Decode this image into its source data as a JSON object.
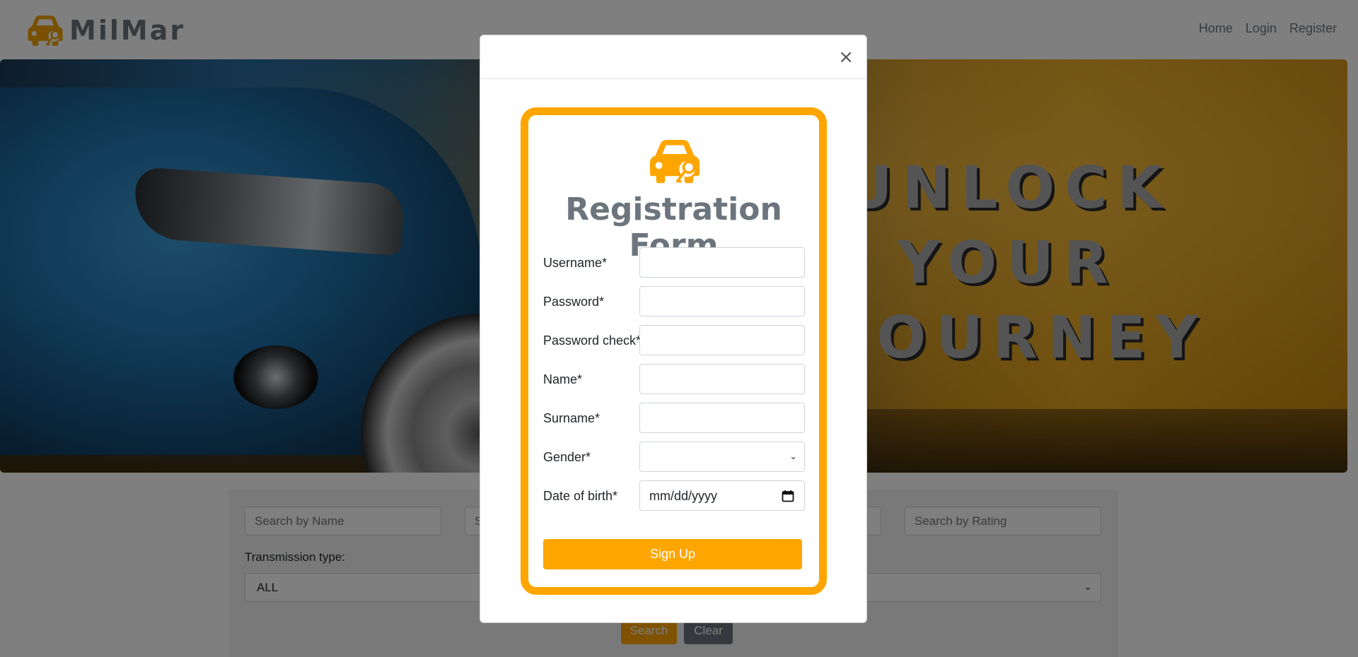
{
  "navbar": {
    "brand_name": "MilMar",
    "brand_icon": "car-key-icon",
    "links": [
      {
        "label": "Home"
      },
      {
        "label": "Login"
      },
      {
        "label": "Register"
      }
    ]
  },
  "hero": {
    "headline_line1": "UNLOCK",
    "headline_line2": "YOUR",
    "headline_line3": "JOURNEY"
  },
  "search": {
    "name_placeholder": "Search by Name",
    "field2_placeholder": "S",
    "rating_placeholder": "Search by Rating",
    "transmission_label": "Transmission type:",
    "transmission_value": "ALL",
    "search_label": "Search",
    "clear_label": "Clear"
  },
  "modal": {
    "close_label": "×",
    "form_icon": "car-key-icon",
    "title": "Registration Form",
    "fields": [
      {
        "label": "Username*",
        "value": ""
      },
      {
        "label": "Password*",
        "value": ""
      },
      {
        "label": "Password check*",
        "value": ""
      },
      {
        "label": "Name*",
        "value": ""
      },
      {
        "label": "Surname*",
        "value": ""
      },
      {
        "label": "Gender*",
        "value": ""
      },
      {
        "label": "Date of birth*",
        "value": "mm/dd/yyyy"
      }
    ],
    "submit_label": "Sign Up"
  },
  "colors": {
    "accent": "#ffa500",
    "text_muted": "#6c757d",
    "secondary_button": "#6c757d"
  }
}
